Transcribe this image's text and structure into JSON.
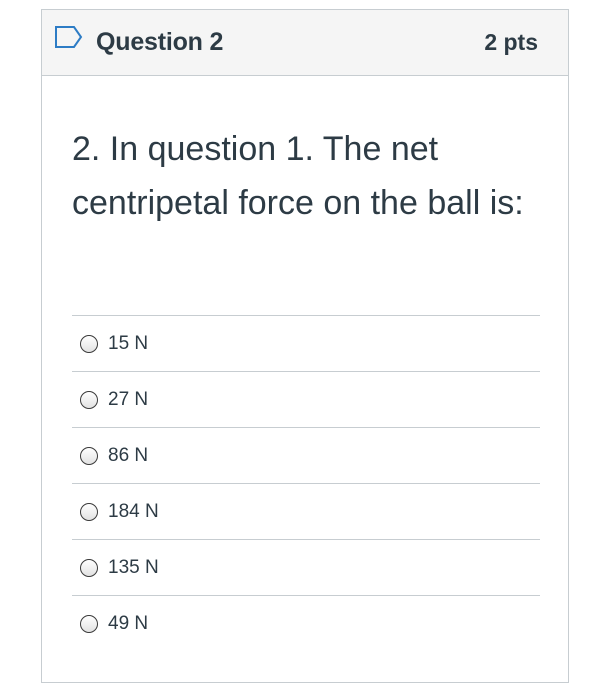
{
  "header": {
    "flag_icon": "flag-outline-icon",
    "title": "Question 2",
    "points": "2 pts"
  },
  "question": {
    "text": "2. In question 1. The net centripetal force on the ball is:"
  },
  "answers": [
    {
      "label": "15 N",
      "selected": false
    },
    {
      "label": "27 N",
      "selected": false
    },
    {
      "label": "86 N",
      "selected": false
    },
    {
      "label": "184 N",
      "selected": false
    },
    {
      "label": "135 N",
      "selected": false
    },
    {
      "label": "49 N",
      "selected": false
    }
  ],
  "colors": {
    "header_bg": "#f5f5f5",
    "border": "#c7cdd1",
    "text": "#2d3b45",
    "flag": "#2d7cc5"
  }
}
